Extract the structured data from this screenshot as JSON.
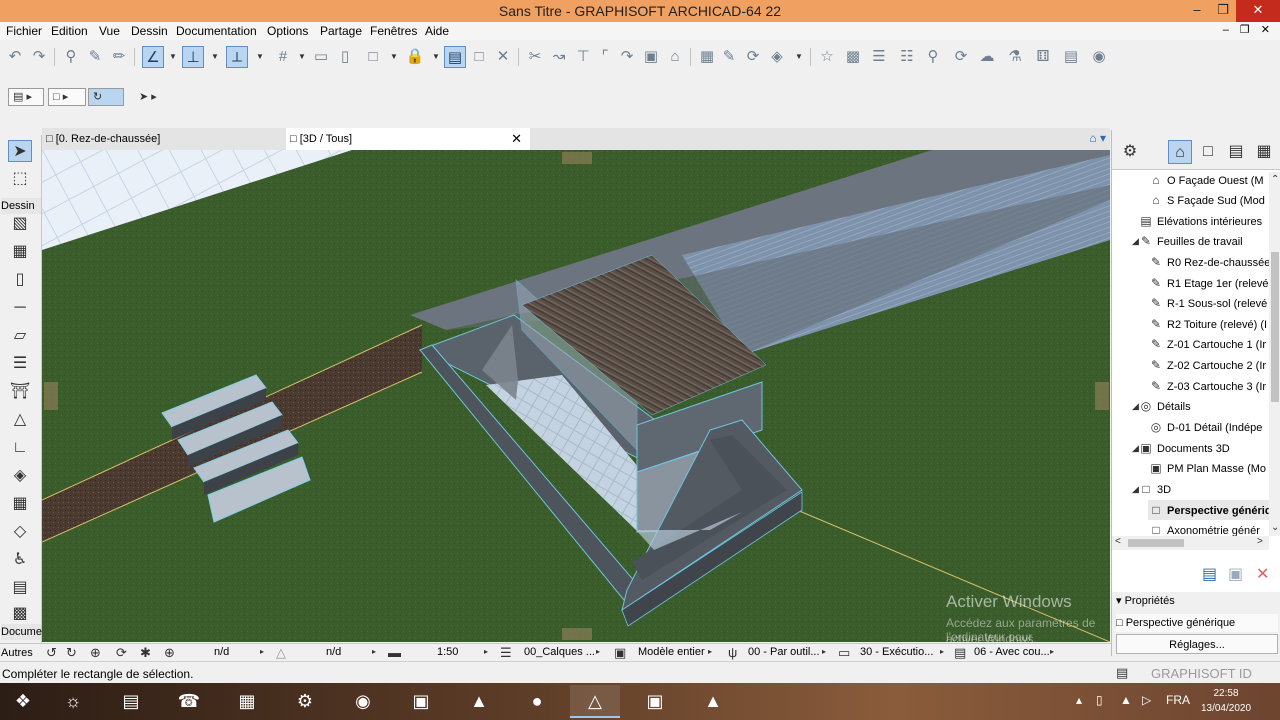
{
  "window": {
    "title": "Sans Titre - GRAPHISOFT ARCHICAD-64 22",
    "minimize_icon": "minimize-icon",
    "maximize_icon": "restore-icon",
    "close_icon": "close-icon"
  },
  "menu": [
    "Fichier",
    "Edition",
    "Vue",
    "Dessin",
    "Documentation",
    "Options",
    "Partage",
    "Fenêtres",
    "Aide"
  ],
  "tabs": [
    {
      "label": "[0. Rez-de-chaussée]"
    },
    {
      "label": "[3D / Tous]"
    }
  ],
  "toolbox": {
    "section_dessin": "Dessin",
    "section_docume": "Docume",
    "section_autres": "Autres"
  },
  "navigator": {
    "items": [
      {
        "label": "O Façade Ouest (M",
        "icon": "elevation-icon"
      },
      {
        "label": "S Façade Sud (Mod",
        "icon": "elevation-icon"
      },
      {
        "label": "Elévations intérieures",
        "icon": "interior-elevation-icon"
      },
      {
        "label": "Feuilles de travail",
        "icon": "worksheet-icon"
      },
      {
        "label": "R0 Rez-de-chaussée",
        "icon": "worksheet-icon"
      },
      {
        "label": "R1 Etage 1er (relevé",
        "icon": "worksheet-icon"
      },
      {
        "label": "R-1 Sous-sol (relevé",
        "icon": "worksheet-icon"
      },
      {
        "label": "R2 Toiture (relevé) (I",
        "icon": "worksheet-icon"
      },
      {
        "label": "Z-01 Cartouche 1 (Ir",
        "icon": "worksheet-icon"
      },
      {
        "label": "Z-02 Cartouche 2 (Ir",
        "icon": "worksheet-icon"
      },
      {
        "label": "Z-03 Cartouche 3 (Ir",
        "icon": "worksheet-icon"
      },
      {
        "label": "Détails",
        "icon": "detail-icon"
      },
      {
        "label": "D-01 Détail (Indépe",
        "icon": "detail-icon"
      },
      {
        "label": "Documents 3D",
        "icon": "document-3d-icon"
      },
      {
        "label": "PM Plan Masse (Mo",
        "icon": "document-3d-icon"
      },
      {
        "label": "3D",
        "icon": "3d-icon"
      },
      {
        "label": "Perspective génériq",
        "icon": "perspective-icon"
      },
      {
        "label": "Axonométrie génér",
        "icon": "axonometry-icon"
      }
    ]
  },
  "properties": {
    "header": "Propriétés",
    "value": "Perspective générique",
    "button": "Réglages..."
  },
  "infobar": {
    "nd1": "n/d",
    "nd2": "n/d",
    "scale": "1:50",
    "layers": "00_Calques ...",
    "model": "Modèle entier",
    "pen": "00 - Par outil...",
    "override": "30 - Exécutio...",
    "renovation": "06 - Avec cou..."
  },
  "status": {
    "message": "Compléter le rectangle de sélection.",
    "brand": "GRAPHISOFT ID"
  },
  "watermark": {
    "line1": "Activer Windows",
    "line2": "Accédez aux paramètres de l'ordinateur pour",
    "line3": "activer Windows."
  },
  "taskbar": {
    "lang": "FRA",
    "time": "22:58",
    "date": "13/04/2020"
  },
  "colors": {
    "titlebar": "#f0a060",
    "selection": "#b9d5ef",
    "grass": "#3a5a2b",
    "accent": "#2a6bb2"
  }
}
